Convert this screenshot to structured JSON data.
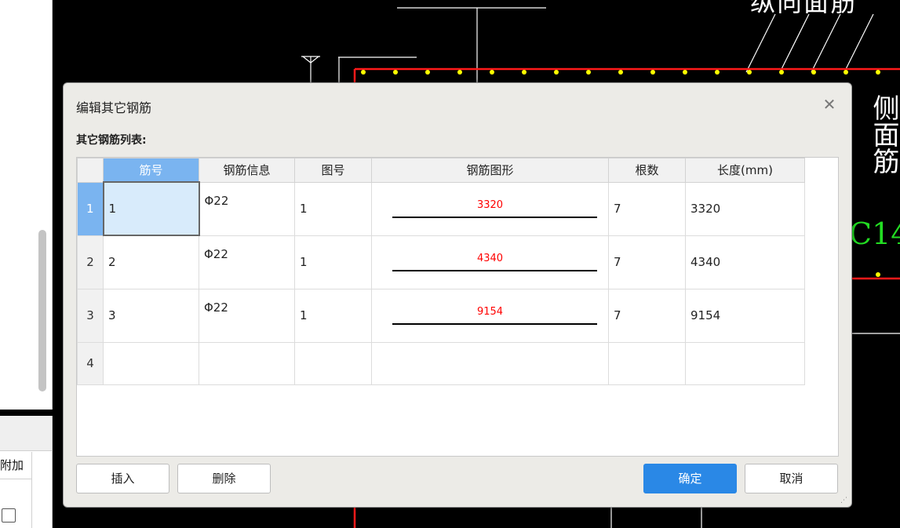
{
  "background_panel": {
    "label": "附加"
  },
  "cad": {
    "text_top_right": "纵向面筋",
    "text_vertical": "侧面筋",
    "text_green": "C14"
  },
  "dialog": {
    "title": "编辑其它钢筋",
    "close_icon": "close-icon",
    "list_label": "其它钢筋列表:",
    "columns": [
      "筋号",
      "钢筋信息",
      "图号",
      "钢筋图形",
      "根数",
      "长度(mm)"
    ],
    "rows": [
      {
        "num": "1",
        "bar_no": "1",
        "info": "Φ22",
        "fig": "1",
        "shape_len": "3320",
        "count": "7",
        "length": "3320"
      },
      {
        "num": "2",
        "bar_no": "2",
        "info": "Φ22",
        "fig": "1",
        "shape_len": "4340",
        "count": "7",
        "length": "4340"
      },
      {
        "num": "3",
        "bar_no": "3",
        "info": "Φ22",
        "fig": "1",
        "shape_len": "9154",
        "count": "7",
        "length": "9154"
      },
      {
        "num": "4",
        "bar_no": "",
        "info": "",
        "fig": "",
        "shape_len": "",
        "count": "",
        "length": ""
      }
    ],
    "buttons": {
      "insert": "插入",
      "delete": "删除",
      "ok": "确定",
      "cancel": "取消"
    },
    "colors": {
      "accent": "#2a88e6",
      "header_active": "#7ab4f0",
      "shape_text": "#ff0000"
    }
  }
}
